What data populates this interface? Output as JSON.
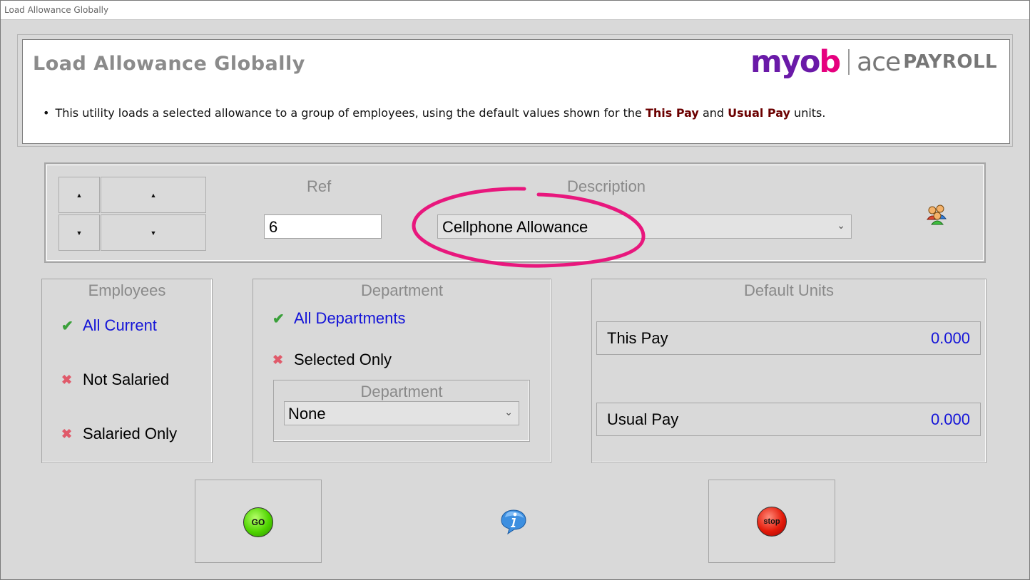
{
  "window": {
    "title": "Load Allowance Globally"
  },
  "header": {
    "title": "Load Allowance Globally",
    "logo_myob_prefix": "myo",
    "logo_myob_suffix": "b",
    "logo_ace": "ace",
    "logo_payroll": "PAYROLL",
    "bullet": "•",
    "info_pre": "This utility loads a selected allowance to a group of employees, using the default values shown for the",
    "info_this_pay": "This Pay",
    "info_and": "and",
    "info_usual_pay": "Usual Pay",
    "info_post": "units."
  },
  "nav": {
    "up_arrow": "▲",
    "down_arrow": "▼",
    "ref_label": "Ref",
    "ref_value": "6",
    "description_label": "Description",
    "description_value": "Cellphone Allowance",
    "chevron": "⌄"
  },
  "employees": {
    "title": "Employees",
    "options": [
      {
        "label": "All Current",
        "selected": true
      },
      {
        "label": "Not Salaried",
        "selected": false
      },
      {
        "label": "Salaried Only",
        "selected": false
      }
    ]
  },
  "department": {
    "title": "Department",
    "options": [
      {
        "label": "All Departments",
        "selected": true
      },
      {
        "label": "Selected Only",
        "selected": false
      }
    ],
    "sub_title": "Department",
    "select_value": "None"
  },
  "default_units": {
    "title": "Default Units",
    "this_pay_label": "This Pay",
    "this_pay_value": "0.000",
    "usual_pay_label": "Usual Pay",
    "usual_pay_value": "0.000"
  },
  "actions": {
    "go_label": "GO",
    "stop_label": "stop"
  },
  "marks": {
    "check": "✔",
    "cross": "✖"
  },
  "colors": {
    "selected_text": "#1414d8",
    "highlight": "#e8177d",
    "emphasis": "#6b0000",
    "background": "#d9d9d9"
  }
}
